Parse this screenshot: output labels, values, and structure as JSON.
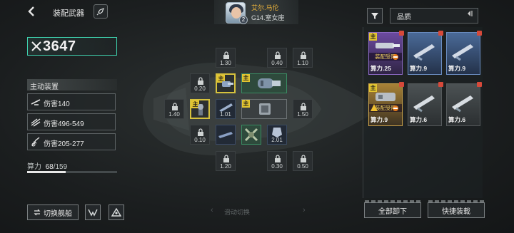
{
  "header": {
    "back_icon": "chevron-left-icon",
    "title": "装配武器",
    "rocket_icon": "rocket-icon"
  },
  "pilot": {
    "name": "艾尔.马伦",
    "ship": "G14.室女座",
    "level": "2"
  },
  "power": {
    "value": "3647",
    "icon": "crossed-swords-icon"
  },
  "active_equipment": {
    "label": "主动装置",
    "stats": [
      {
        "icon": "turret-icon",
        "text": "伤害140"
      },
      {
        "icon": "missile-icon",
        "text": "伤害496-549"
      },
      {
        "icon": "laser-icon",
        "text": "伤害205-277"
      }
    ]
  },
  "capacity": {
    "label": "算力",
    "current": "68",
    "max": "/159",
    "fraction": 0.428
  },
  "grid": {
    "locked_slots": [
      {
        "id": "r0c1",
        "value": "1.30"
      },
      {
        "id": "r0c3",
        "value": "0.40"
      },
      {
        "id": "r0c4",
        "value": "1.10"
      },
      {
        "id": "r1c0",
        "value": "0.20"
      },
      {
        "id": "r2c_1",
        "value": "1.40"
      },
      {
        "id": "r2c4",
        "value": "1.50"
      },
      {
        "id": "r3c0",
        "value": "0.10"
      },
      {
        "id": "r4c1",
        "value": "1.20"
      },
      {
        "id": "r4c3",
        "value": "0.30"
      },
      {
        "id": "r4c4",
        "value": "0.50"
      }
    ],
    "equipped": [
      {
        "id": "e1",
        "tag": "主",
        "value": ""
      },
      {
        "id": "e2",
        "tag": "主",
        "value": ""
      },
      {
        "id": "e3",
        "tag": "主",
        "value": ""
      },
      {
        "id": "e4",
        "tag": "",
        "value": "1.01"
      },
      {
        "id": "e5",
        "tag": "主",
        "value": ""
      },
      {
        "id": "e6",
        "tag": "主",
        "value": ""
      },
      {
        "id": "e7",
        "tag": "",
        "value": ""
      },
      {
        "id": "e8",
        "tag": "",
        "value": ""
      },
      {
        "id": "e9",
        "tag": "",
        "value": "2.01"
      }
    ]
  },
  "swipe_hint": "滑动切换",
  "filter": {
    "icon": "filter-icon",
    "sort_label": "品质",
    "sort_icon": "sort-toggle-icon"
  },
  "inventory": [
    {
      "tag": "主",
      "limit": "装配受限",
      "power": "算力.25"
    },
    {
      "tag": "",
      "limit": "",
      "power": "算力.9"
    },
    {
      "tag": "",
      "limit": "",
      "power": "算力.9"
    },
    {
      "tag": "主",
      "limit": "装配受限",
      "power": "算力.9"
    },
    {
      "tag": "",
      "limit": "",
      "power": "算力.6"
    },
    {
      "tag": "",
      "limit": "",
      "power": "算力.6"
    }
  ],
  "buttons": {
    "switch_ship": "切换舰船",
    "unequip_all": "全部卸下",
    "quick_equip": "快捷装载"
  }
}
